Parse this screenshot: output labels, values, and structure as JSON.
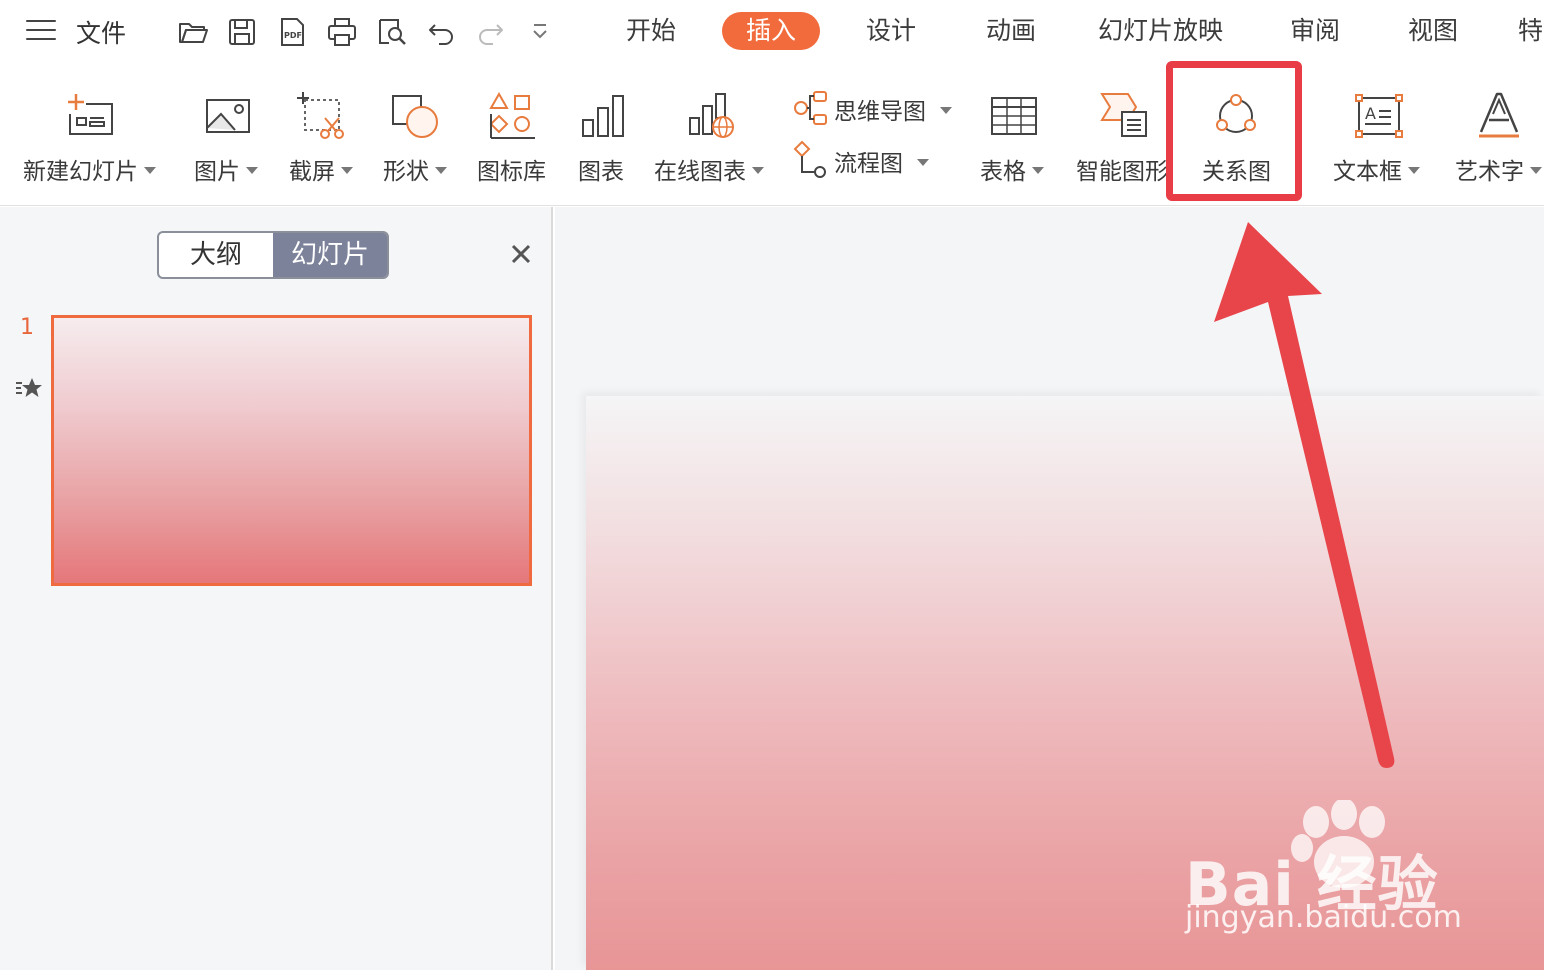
{
  "menu": {
    "file_label": "文件",
    "tabs": [
      {
        "label": "开始"
      },
      {
        "label": "插入"
      },
      {
        "label": "设计"
      },
      {
        "label": "动画"
      },
      {
        "label": "幻灯片放映"
      },
      {
        "label": "审阅"
      },
      {
        "label": "视图"
      },
      {
        "label": "特"
      }
    ],
    "active_tab": "插入"
  },
  "ribbon": {
    "items": [
      {
        "label": "新建幻灯片"
      },
      {
        "label": "图片"
      },
      {
        "label": "截屏"
      },
      {
        "label": "形状"
      },
      {
        "label": "图标库"
      },
      {
        "label": "图表"
      },
      {
        "label": "在线图表"
      },
      {
        "label": "表格"
      },
      {
        "label": "智能图形"
      },
      {
        "label": "关系图"
      },
      {
        "label": "文本框"
      },
      {
        "label": "艺术字"
      }
    ],
    "small_items": [
      {
        "label": "思维导图"
      },
      {
        "label": "流程图"
      }
    ]
  },
  "left_panel": {
    "tab_outline": "大纲",
    "tab_slides": "幻灯片",
    "slide_number": "1"
  },
  "watermark": {
    "brand": "Bai  经验",
    "url": "jingyan.baidu.com"
  },
  "colors": {
    "accent": "#f26b3c",
    "highlight": "#e83c46",
    "toggle_active": "#7b8299"
  }
}
